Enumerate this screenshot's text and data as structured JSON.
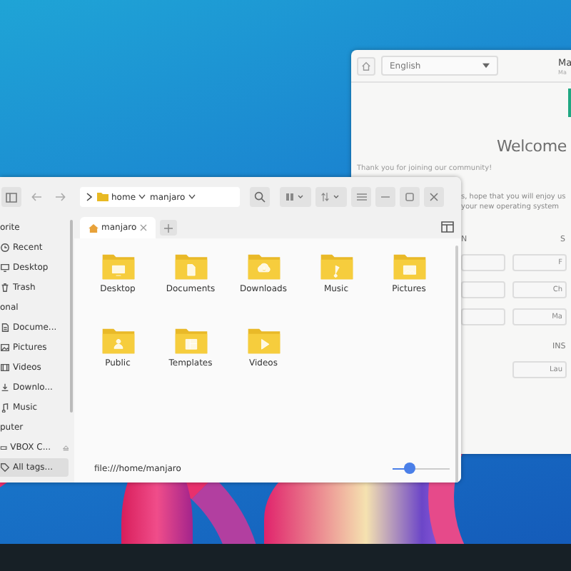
{
  "welcome": {
    "language": "English",
    "title": "Ma",
    "subtitle": "Ma",
    "heading": "Welcome",
    "thanks": "Thank you for joining our community!",
    "intro_lines": [
      "s, hope that you will enjoy us",
      "your new operating system"
    ],
    "sections": [
      {
        "label": "N"
      },
      {
        "label": "S"
      }
    ],
    "buttons": [
      {
        "label": "F"
      },
      {
        "label": "Ch"
      },
      {
        "label": "Ma"
      }
    ],
    "install_heading": "INS",
    "install_button": "Lau"
  },
  "file_manager": {
    "path": [
      {
        "label": "home"
      },
      {
        "label": "manjaro"
      }
    ],
    "sidebar": [
      {
        "kind": "heading",
        "label": "orite"
      },
      {
        "kind": "recent",
        "label": "Recent",
        "selected": false
      },
      {
        "kind": "desktop",
        "label": "Desktop",
        "selected": false
      },
      {
        "kind": "trash",
        "label": "Trash",
        "selected": false
      },
      {
        "kind": "heading",
        "label": "onal"
      },
      {
        "kind": "document",
        "label": "Docume...",
        "selected": false
      },
      {
        "kind": "picture",
        "label": "Pictures",
        "selected": false
      },
      {
        "kind": "video",
        "label": "Videos",
        "selected": false
      },
      {
        "kind": "download",
        "label": "Downlo...",
        "selected": false
      },
      {
        "kind": "music",
        "label": "Music",
        "selected": false
      },
      {
        "kind": "heading",
        "label": "puter"
      },
      {
        "kind": "drive",
        "label": "VBOX C...",
        "selected": false
      },
      {
        "kind": "tag",
        "label": "All tags...",
        "selected": true
      }
    ],
    "tabs": [
      {
        "label": "manjaro",
        "selected": true
      }
    ],
    "folders": [
      {
        "kind": "desktop",
        "label": "Desktop"
      },
      {
        "kind": "document",
        "label": "Documents"
      },
      {
        "kind": "download",
        "label": "Downloads"
      },
      {
        "kind": "music",
        "label": "Music"
      },
      {
        "kind": "picture",
        "label": "Pictures"
      },
      {
        "kind": "public",
        "label": "Public"
      },
      {
        "kind": "template",
        "label": "Templates"
      },
      {
        "kind": "video",
        "label": "Videos"
      }
    ],
    "location": "file:///home/manjaro",
    "zoom": {
      "level": 0.3
    }
  }
}
